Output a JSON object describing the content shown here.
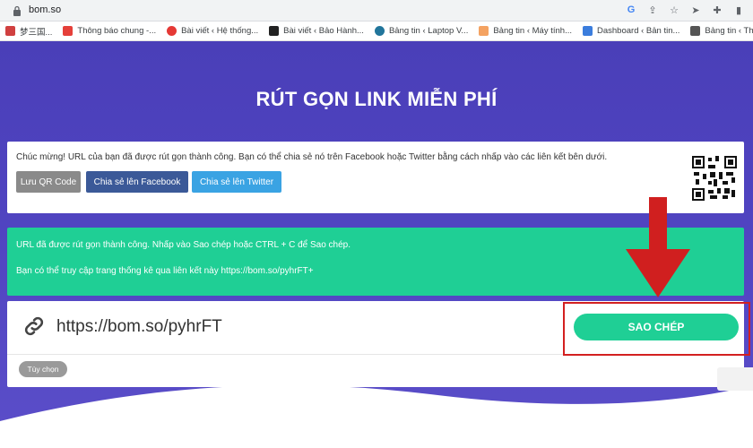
{
  "browser": {
    "url": "bom.so",
    "bookmarks": [
      {
        "label": "梦三国...",
        "color": "#d04040"
      },
      {
        "label": "Thông báo chung -...",
        "color": "#e5403a"
      },
      {
        "label": "Bài viết ‹ Hệ thống...",
        "color": "#e53935"
      },
      {
        "label": "Bài viết ‹ Bảo Hành...",
        "color": "#222222"
      },
      {
        "label": "Bảng tin ‹ Laptop V...",
        "color": "#21759b"
      },
      {
        "label": "Bảng tin ‹ Máy tính...",
        "color": "#f4a261"
      },
      {
        "label": "Dashboard ‹ Bản tin...",
        "color": "#3b7ddd"
      },
      {
        "label": "Bảng tin ‹ Thủ thuậ...",
        "color": "#555555"
      }
    ]
  },
  "page": {
    "title": "RÚT GỌN LINK MIỄN PHÍ",
    "success_card": {
      "message": "Chúc mừng! URL của bạn đã được rút gọn thành công. Bạn có thể chia sẻ nó trên Facebook hoặc Twitter bằng cách nhấp vào các liên kết bên dưới.",
      "save_qr_label": "Lưu QR Code",
      "share_facebook_label": "Chia sẻ lên Facebook",
      "share_twitter_label": "Chia sẻ lên Twitter"
    },
    "info_card": {
      "line1": "URL đã được rút gọn thành công. Nhấp vào Sao chép hoặc CTRL + C để Sao chép.",
      "line2": "Bạn có thể truy cập trang thống kê qua liên kết này https://bom.so/pyhrFT+"
    },
    "result_card": {
      "short_url": "https://bom.so/pyhrFT",
      "copy_label": "SAO CHÉP",
      "options_label": "Tùy chọn"
    }
  },
  "colors": {
    "brand_purple": "#4f43c0",
    "accent_green": "#1fcf95",
    "facebook_blue": "#3b5998",
    "twitter_blue": "#3aa3e3",
    "annotation_red": "#d32020"
  }
}
